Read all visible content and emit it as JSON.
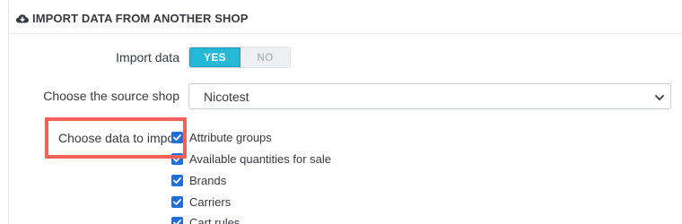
{
  "panel": {
    "title": "IMPORT DATA FROM ANOTHER SHOP",
    "title_icon": "cloud-download-icon"
  },
  "import_data": {
    "label": "Import data",
    "yes_label": "YES",
    "no_label": "NO",
    "selected": "YES"
  },
  "source_shop": {
    "label": "Choose the source shop",
    "value": "Nicotest"
  },
  "data_to_import": {
    "label": "Choose data to impo",
    "items": [
      {
        "label": "Attribute groups",
        "checked": true
      },
      {
        "label": "Available quantities for sale",
        "checked": true
      },
      {
        "label": "Brands",
        "checked": true
      },
      {
        "label": "Carriers",
        "checked": true
      },
      {
        "label": "Cart rules",
        "checked": true
      }
    ]
  },
  "colors": {
    "accent": "#25b9d7",
    "checkbox": "#1e6fd9",
    "highlight": "#f2625a"
  }
}
